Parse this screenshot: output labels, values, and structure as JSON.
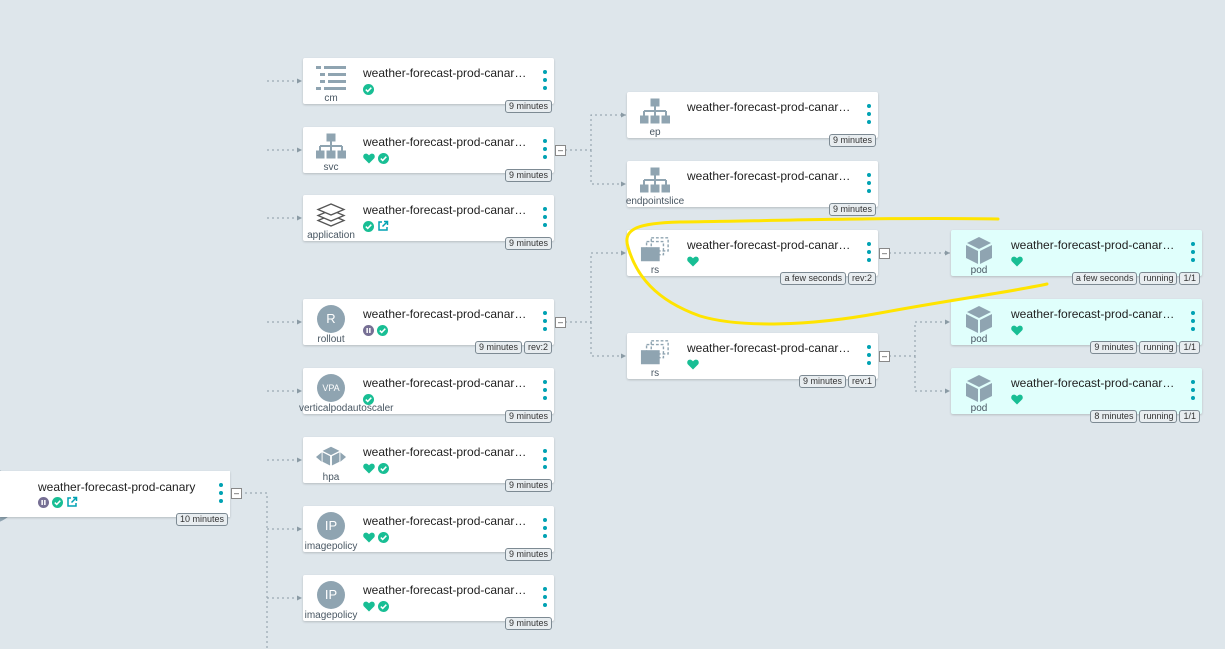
{
  "colors": {
    "background": "#dee6eb",
    "accent": "#00a2b3",
    "healthy": "#18be94",
    "suspended": "#766f94",
    "highlight": "#ffe400",
    "pod_bg": "#e0fffc"
  },
  "root": {
    "name": "weather-forecast-prod-canary",
    "status_icons": [
      "paused-icon",
      "synced-icon",
      "external-link-icon"
    ],
    "age": "10 minutes",
    "collapse": "–"
  },
  "column1": [
    {
      "kind": "cm",
      "icon": "configmap-list-icon",
      "name": "weather-forecast-prod-canary...",
      "status_icons": [
        "synced-icon"
      ],
      "tags": [
        "9 minutes"
      ]
    },
    {
      "kind": "svc",
      "icon": "service-tree-icon",
      "name": "weather-forecast-prod-canary...",
      "status_icons": [
        "heart-icon",
        "synced-icon"
      ],
      "tags": [
        "9 minutes"
      ],
      "collapse": "–"
    },
    {
      "kind": "application",
      "icon": "layers-icon",
      "name": "weather-forecast-prod-canary...",
      "status_icons": [
        "synced-icon",
        "external-link-icon"
      ],
      "tags": [
        "9 minutes"
      ]
    },
    {
      "kind": "rollout",
      "icon": "rollout-circle-icon",
      "icon_text": "R",
      "name": "weather-forecast-prod-canary...",
      "status_icons": [
        "paused-icon",
        "synced-icon"
      ],
      "tags": [
        "9 minutes",
        "rev:2"
      ],
      "collapse": "–"
    },
    {
      "kind": "verticalpodautoscaler",
      "icon": "vpa-circle-icon",
      "icon_text": "VPA",
      "name": "weather-forecast-prod-canary...",
      "status_icons": [
        "synced-icon"
      ],
      "tags": [
        "9 minutes"
      ]
    },
    {
      "kind": "hpa",
      "icon": "hpa-cube-icon",
      "name": "weather-forecast-prod-canary...",
      "status_icons": [
        "heart-icon",
        "synced-icon"
      ],
      "tags": [
        "9 minutes"
      ]
    },
    {
      "kind": "imagepolicy",
      "icon": "ip-circle-icon",
      "icon_text": "IP",
      "name": "weather-forecast-prod-canary...",
      "status_icons": [
        "heart-icon",
        "synced-icon"
      ],
      "tags": [
        "9 minutes"
      ]
    },
    {
      "kind": "imagepolicy",
      "icon": "ip-circle-icon",
      "icon_text": "IP",
      "name": "weather-forecast-prod-canary...",
      "status_icons": [
        "heart-icon",
        "synced-icon"
      ],
      "tags": [
        "9 minutes"
      ]
    }
  ],
  "column2": [
    {
      "kind": "ep",
      "icon": "endpoint-tree-icon",
      "name": "weather-forecast-prod-canary...",
      "status_icons": [],
      "tags": [
        "9 minutes"
      ]
    },
    {
      "kind": "endpointslice",
      "icon": "endpoint-tree-icon",
      "name": "weather-forecast-prod-canary...",
      "status_icons": [],
      "tags": [
        "9 minutes"
      ]
    },
    {
      "kind": "rs",
      "icon": "replicaset-icon",
      "name": "weather-forecast-prod-canary...",
      "status_icons": [
        "heart-icon"
      ],
      "tags": [
        "a few seconds",
        "rev:2"
      ],
      "collapse": "–"
    },
    {
      "kind": "rs",
      "icon": "replicaset-icon",
      "name": "weather-forecast-prod-canary...",
      "status_icons": [
        "heart-icon"
      ],
      "tags": [
        "9 minutes",
        "rev:1"
      ],
      "collapse": "–"
    }
  ],
  "column3": [
    {
      "kind": "pod",
      "icon": "pod-cube-icon",
      "name": "weather-forecast-prod-canary...",
      "status_icons": [
        "heart-icon"
      ],
      "tags": [
        "a few seconds",
        "running",
        "1/1"
      ]
    },
    {
      "kind": "pod",
      "icon": "pod-cube-icon",
      "name": "weather-forecast-prod-canary...",
      "status_icons": [
        "heart-icon"
      ],
      "tags": [
        "9 minutes",
        "running",
        "1/1"
      ]
    },
    {
      "kind": "pod",
      "icon": "pod-cube-icon",
      "name": "weather-forecast-prod-canary...",
      "status_icons": [
        "heart-icon"
      ],
      "tags": [
        "8 minutes",
        "running",
        "1/1"
      ]
    }
  ]
}
